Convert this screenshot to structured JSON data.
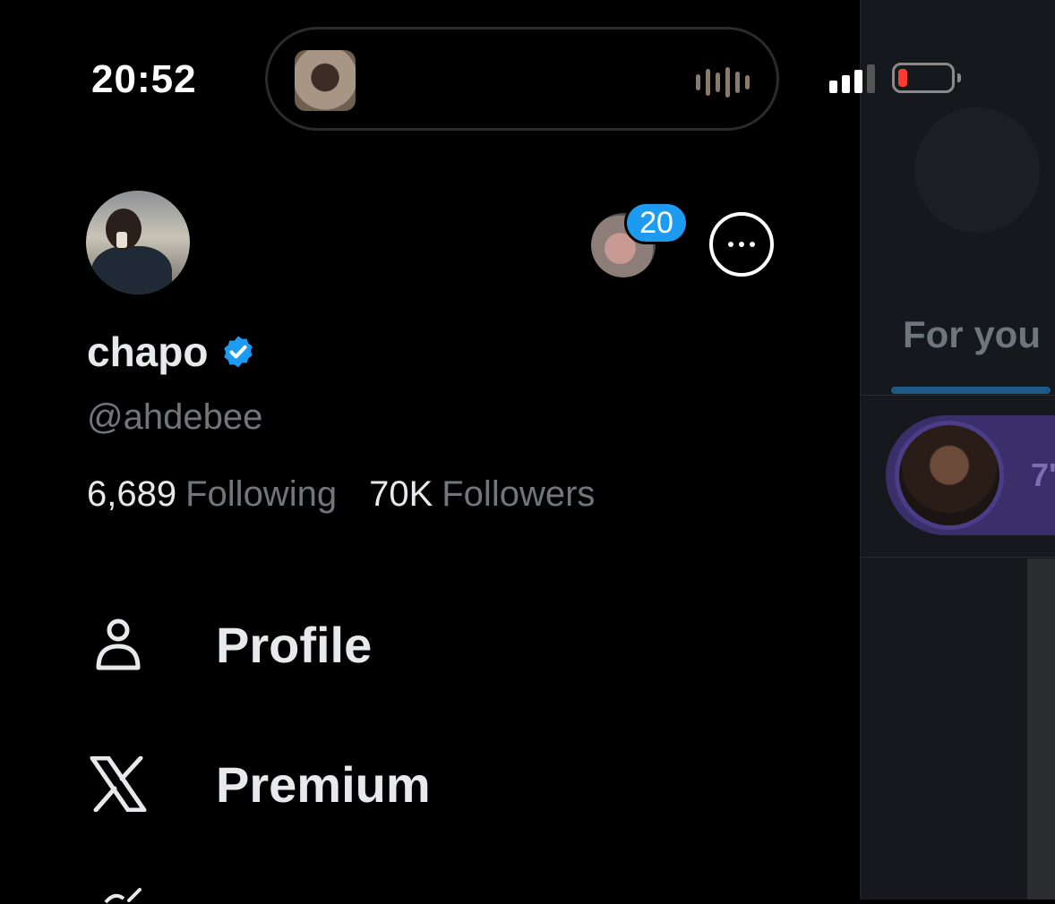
{
  "status_bar": {
    "time": "20:52",
    "battery_color": "#ff3b30"
  },
  "dynamic_island": {
    "thumbnail": "now-playing-artwork",
    "indicator": "audio-waveform-icon"
  },
  "account": {
    "name": "chapo",
    "handle": "@ahdebee",
    "verified": true,
    "following_count": "6,689",
    "following_label": "Following",
    "followers_count": "70K",
    "followers_label": "Followers",
    "notification_badge": "20"
  },
  "menu": {
    "items": [
      {
        "label": "Profile",
        "icon": "person-icon"
      },
      {
        "label": "Premium",
        "icon": "x-logo-icon"
      }
    ]
  },
  "feed_preview": {
    "tab_label": "For you",
    "space_count": "7'"
  },
  "colors": {
    "accent": "#1d9bf0",
    "background": "#000000",
    "muted_text": "#71767b",
    "space_card": "#3a2f6b"
  }
}
